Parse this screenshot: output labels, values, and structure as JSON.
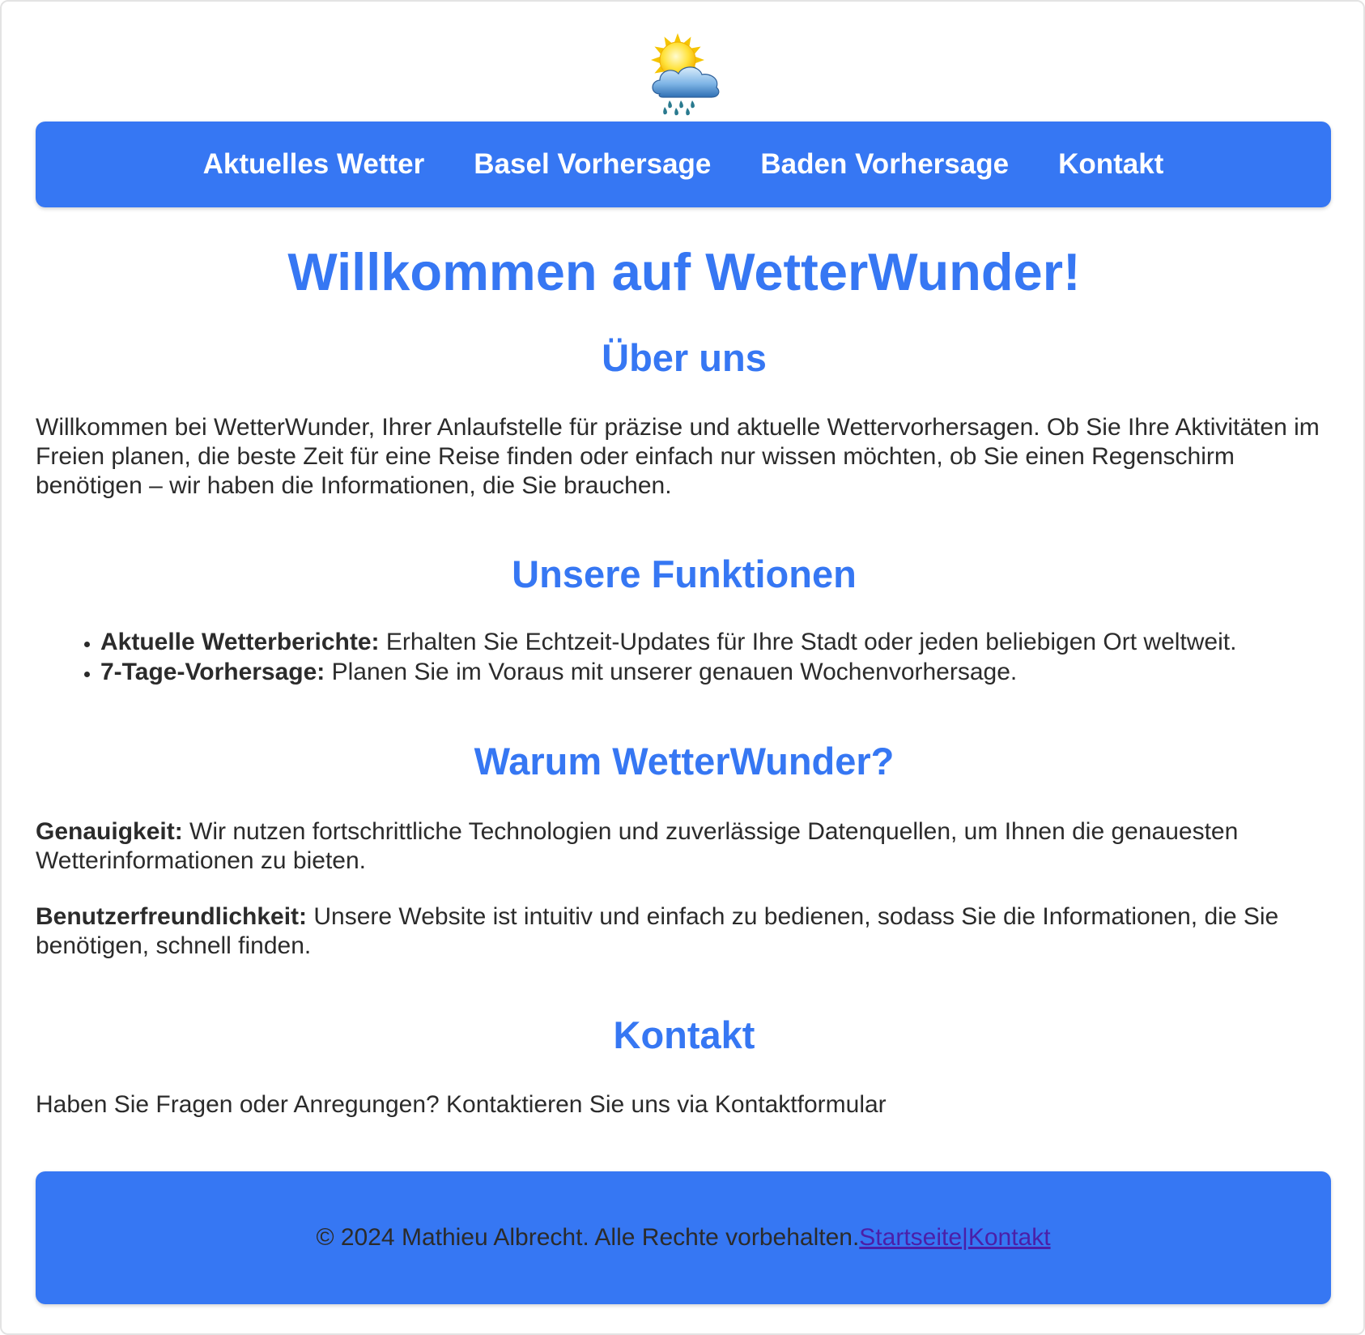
{
  "logo": {
    "icon": "sun-behind-rain-cloud-icon"
  },
  "nav": {
    "items": [
      {
        "label": "Aktuelles Wetter"
      },
      {
        "label": "Basel Vorhersage"
      },
      {
        "label": "Baden Vorhersage"
      },
      {
        "label": "Kontakt"
      }
    ]
  },
  "main": {
    "title": "Willkommen auf WetterWunder!",
    "about": {
      "heading": "Über uns",
      "text": "Willkommen bei WetterWunder, Ihrer Anlaufstelle für präzise und aktuelle Wettervorhersagen. Ob Sie Ihre Aktivitäten im Freien planen, die beste Zeit für eine Reise finden oder einfach nur wissen möchten, ob Sie einen Regenschirm benötigen – wir haben die Informationen, die Sie brauchen."
    },
    "features": {
      "heading": "Unsere Funktionen",
      "items": [
        {
          "term": "Aktuelle Wetterberichte:",
          "text": " Erhalten Sie Echtzeit-Updates für Ihre Stadt oder jeden beliebigen Ort weltweit."
        },
        {
          "term": "7-Tage-Vorhersage:",
          "text": " Planen Sie im Voraus mit unserer genauen Wochenvorhersage."
        }
      ]
    },
    "why": {
      "heading": "Warum WetterWunder?",
      "points": [
        {
          "term": "Genauigkeit:",
          "text": " Wir nutzen fortschrittliche Technologien und zuverlässige Datenquellen, um Ihnen die genauesten Wetterinformationen zu bieten."
        },
        {
          "term": "Benutzerfreundlichkeit:",
          "text": " Unsere Website ist intuitiv und einfach zu bedienen, sodass Sie die Informationen, die Sie benötigen, schnell finden."
        }
      ]
    },
    "contact": {
      "heading": "Kontakt",
      "text": "Haben Sie Fragen oder Anregungen? Kontaktieren Sie uns via Kontaktformular"
    }
  },
  "footer": {
    "copyright": "© 2024 Mathieu Albrecht. Alle Rechte vorbehalten.",
    "link_home": "Startseite",
    "separator": "|",
    "link_contact": "Kontakt"
  },
  "colors": {
    "accent": "#3677f3",
    "text": "#2b2b2b",
    "link": "#4b1fa8",
    "background": "#ffffff"
  }
}
